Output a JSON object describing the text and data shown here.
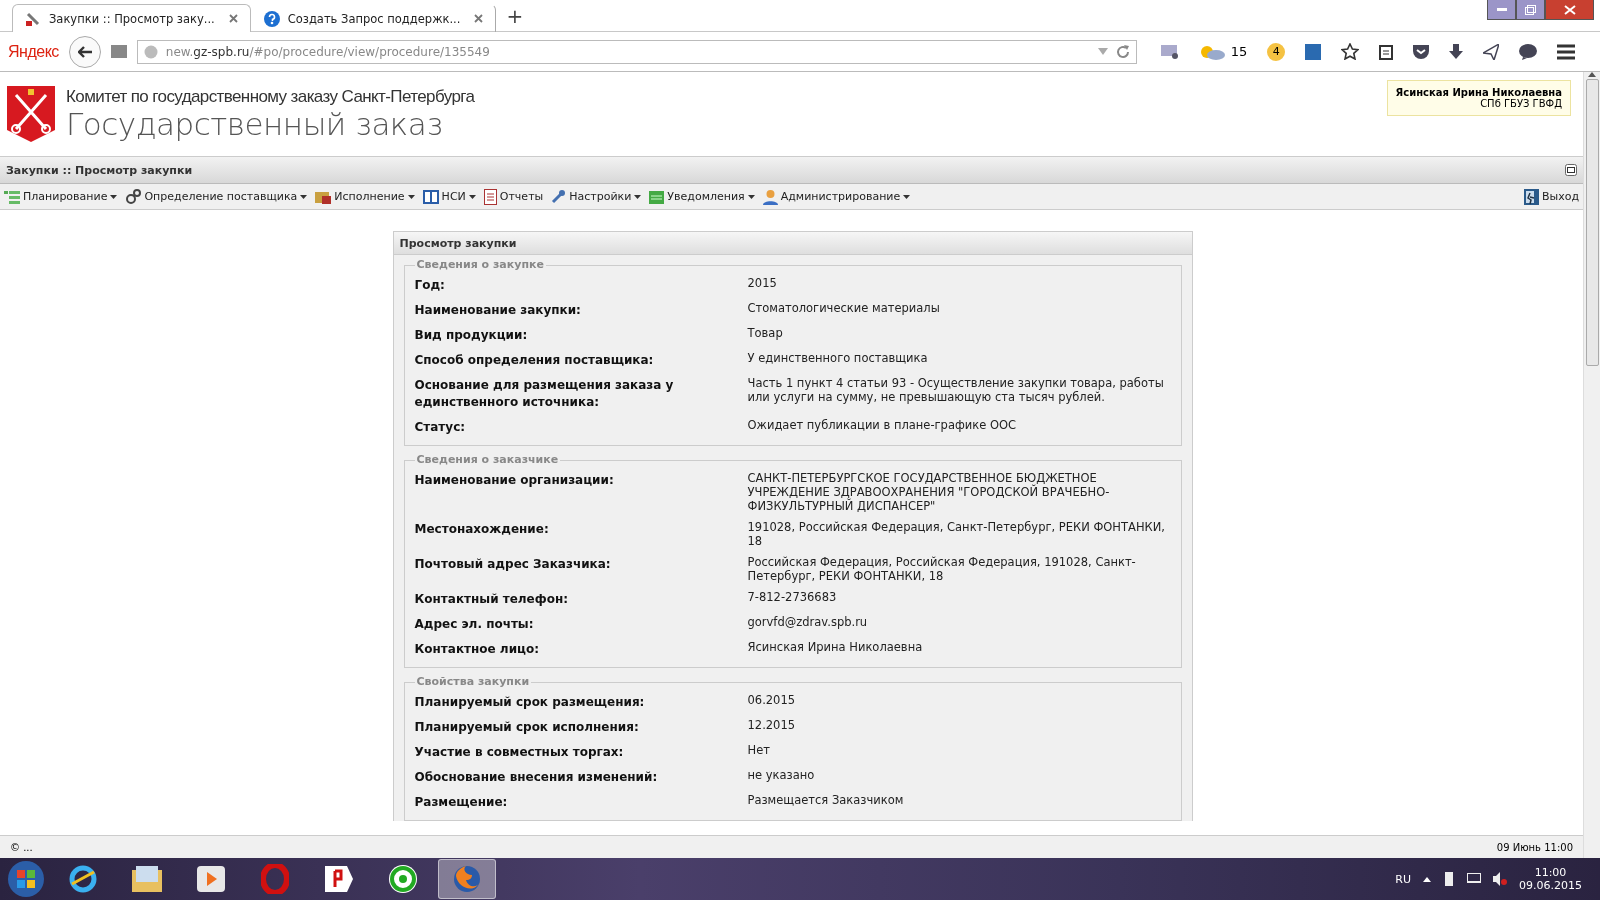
{
  "browser": {
    "tabs": [
      {
        "title": "Закупки :: Просмотр заку...",
        "selected": true
      },
      {
        "title": "Создать Запрос поддержк...",
        "selected": false
      }
    ],
    "new_tab": "+",
    "search_brand": "Яндекс",
    "address": "new.**gz-spb.ru**/#po/procedure/view/procedure/135549",
    "weather": "15",
    "badge": "4"
  },
  "header": {
    "subtitle": "Комитет по государственному заказу Санкт-Петербурга",
    "title": "Государственный заказ",
    "user_name": "Ясинская Ирина Николаевна",
    "user_org": "СПб ГБУЗ ГВФД"
  },
  "page_title": "Закупки :: Просмотр закупки",
  "menu": [
    {
      "label": "Планирование",
      "has_menu": true
    },
    {
      "label": "Определение поставщика",
      "has_menu": true
    },
    {
      "label": "Исполнение",
      "has_menu": true
    },
    {
      "label": "НСИ",
      "has_menu": true
    },
    {
      "label": "Отчеты",
      "has_menu": false
    },
    {
      "label": "Настройки",
      "has_menu": true
    },
    {
      "label": "Уведомления",
      "has_menu": true
    },
    {
      "label": "Администрирование",
      "has_menu": true
    }
  ],
  "exit": "Выход",
  "panel": {
    "title": "Просмотр закупки",
    "sections": [
      {
        "title": "Сведения о закупке",
        "rows": [
          {
            "label": "Год:",
            "value": "2015"
          },
          {
            "label": "Наименование закупки:",
            "value": "Стоматологические материалы"
          },
          {
            "label": "Вид продукции:",
            "value": "Товар"
          },
          {
            "label": "Способ определения поставщика:",
            "value": "У единственного поставщика"
          },
          {
            "label": "Основание для размещения заказа у единственного источника:",
            "value": "Часть 1 пункт 4 статьи 93 - Осуществление закупки товара, работы или услуги на сумму, не превышающую ста тысяч рублей."
          },
          {
            "label": "Статус:",
            "value": "Ожидает публикации в плане-графике ООС"
          }
        ]
      },
      {
        "title": "Сведения о заказчике",
        "rows": [
          {
            "label": "Наименование организации:",
            "value": "САНКТ-ПЕТЕРБУРГСКОЕ ГОСУДАРСТВЕННОЕ БЮДЖЕТНОЕ УЧРЕЖДЕНИЕ ЗДРАВООХРАНЕНИЯ \"ГОРОДСКОЙ ВРАЧЕБНО-ФИЗКУЛЬТУРНЫЙ ДИСПАНСЕР\""
          },
          {
            "label": "Местонахождение:",
            "value": "191028, Российская Федерация, Санкт-Петербург, РЕКИ ФОНТАНКИ, 18"
          },
          {
            "label": "Почтовый адрес Заказчика:",
            "value": "Российская Федерация, Российская Федерация, 191028, Санкт-Петербург, РЕКИ ФОНТАНКИ, 18"
          },
          {
            "label": "Контактный телефон:",
            "value": "7-812-2736683"
          },
          {
            "label": "Адрес эл. почты:",
            "value": "gorvfd@zdrav.spb.ru"
          },
          {
            "label": "Контактное лицо:",
            "value": "Ясинская Ирина Николаевна"
          }
        ]
      },
      {
        "title": "Свойства закупки",
        "rows": [
          {
            "label": "Планируемый срок размещения:",
            "value": "06.2015"
          },
          {
            "label": "Планируемый срок исполнения:",
            "value": "12.2015"
          },
          {
            "label": "Участие в совместных торгах:",
            "value": "Нет"
          },
          {
            "label": "Обоснование внесения изменений:",
            "value": "не указано"
          },
          {
            "label": "Размещение:",
            "value": "Размещается Заказчиком"
          }
        ]
      }
    ]
  },
  "status_bar": {
    "left": "© ...",
    "right": "09 Июнь 11:00"
  },
  "taskbar": {
    "language": "RU",
    "time": "11:00",
    "date": "09.06.2015"
  }
}
